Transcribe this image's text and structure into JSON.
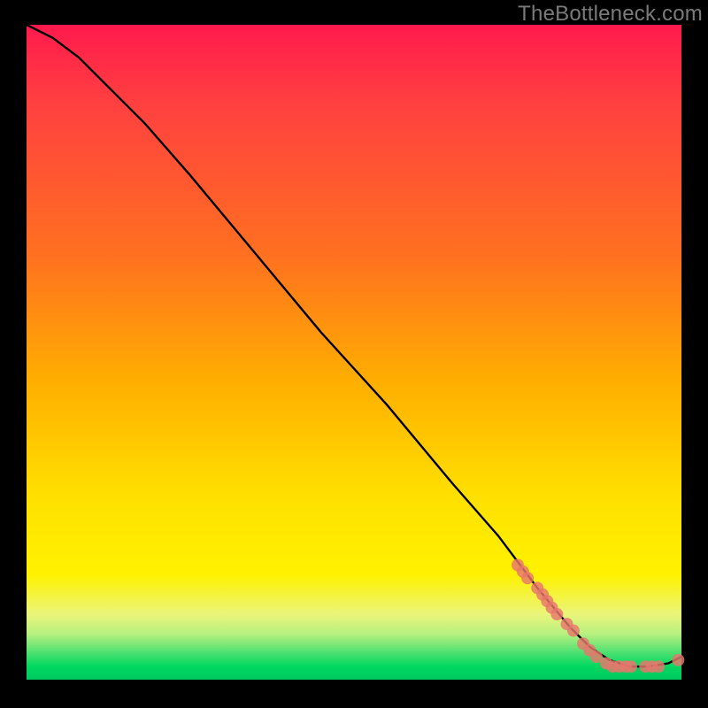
{
  "watermark": "TheBottleneck.com",
  "chart_data": {
    "type": "line",
    "title": "",
    "xlabel": "",
    "ylabel": "",
    "xlim": [
      0,
      100
    ],
    "ylim": [
      0,
      100
    ],
    "curve": {
      "x": [
        0,
        4,
        8,
        12,
        18,
        25,
        35,
        45,
        55,
        65,
        72,
        78,
        83,
        86,
        89,
        92,
        95,
        98,
        100
      ],
      "y": [
        100,
        98,
        95,
        91,
        85,
        77,
        65,
        53,
        42,
        30,
        22,
        14,
        8,
        5,
        3,
        2,
        2,
        2.5,
        3.5
      ]
    },
    "scatter_series": {
      "name": "points",
      "points": [
        {
          "x": 75.0,
          "y": 17.5
        },
        {
          "x": 75.8,
          "y": 16.5
        },
        {
          "x": 76.5,
          "y": 15.5
        },
        {
          "x": 78.0,
          "y": 14.0
        },
        {
          "x": 78.8,
          "y": 13.0
        },
        {
          "x": 79.5,
          "y": 12.0
        },
        {
          "x": 80.2,
          "y": 11.0
        },
        {
          "x": 81.0,
          "y": 10.0
        },
        {
          "x": 82.5,
          "y": 8.5
        },
        {
          "x": 83.5,
          "y": 7.5
        },
        {
          "x": 85.0,
          "y": 5.5
        },
        {
          "x": 86.0,
          "y": 4.5
        },
        {
          "x": 87.0,
          "y": 3.5
        },
        {
          "x": 88.5,
          "y": 2.5
        },
        {
          "x": 89.5,
          "y": 2.0
        },
        {
          "x": 90.5,
          "y": 2.0
        },
        {
          "x": 91.5,
          "y": 2.0
        },
        {
          "x": 92.3,
          "y": 2.0
        },
        {
          "x": 94.5,
          "y": 2.0
        },
        {
          "x": 95.5,
          "y": 2.0
        },
        {
          "x": 96.5,
          "y": 2.0
        },
        {
          "x": 99.5,
          "y": 3.0
        }
      ]
    },
    "colors": {
      "curve": "#000000",
      "points": "#e8766d",
      "gradient_top": "#ff1a4d",
      "gradient_bottom": "#00c860"
    }
  }
}
